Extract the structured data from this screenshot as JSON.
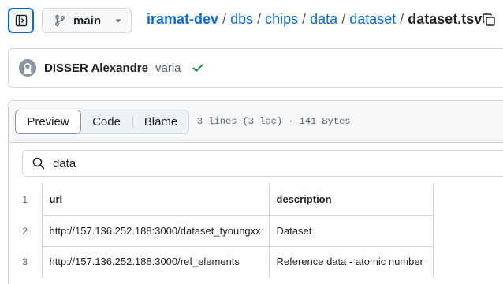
{
  "branch": {
    "name": "main"
  },
  "breadcrumb": {
    "repo": "iramat-dev",
    "sep": "/",
    "parts": [
      "dbs",
      "chips",
      "data",
      "dataset"
    ],
    "file": "dataset.tsv"
  },
  "commit": {
    "author": "DISSER Alexandre",
    "message": "varia"
  },
  "file_view": {
    "tabs": [
      "Preview",
      "Code",
      "Blame"
    ],
    "active_tab": "Preview",
    "info": "3 lines (3 loc) · 141 Bytes"
  },
  "search": {
    "value": "data"
  },
  "table": {
    "line_numbers": [
      "1",
      "2",
      "3"
    ],
    "header": [
      "url",
      "description"
    ],
    "rows": [
      [
        "http://157.136.252.188:3000/dataset_tyoungxx",
        "Dataset"
      ],
      [
        "http://157.136.252.188:3000/ref_elements",
        "Reference data - atomic number"
      ]
    ]
  },
  "colors": {
    "accent": "#0969da",
    "success": "#1a7f37",
    "border": "#d0d7de"
  },
  "icons": {
    "sidebar": "sidebar-expand-icon",
    "branch": "git-branch-icon",
    "caret": "triangle-down-icon",
    "copy": "copy-icon",
    "avatar": "github-avatar-icon",
    "check": "check-icon",
    "search": "search-icon"
  }
}
